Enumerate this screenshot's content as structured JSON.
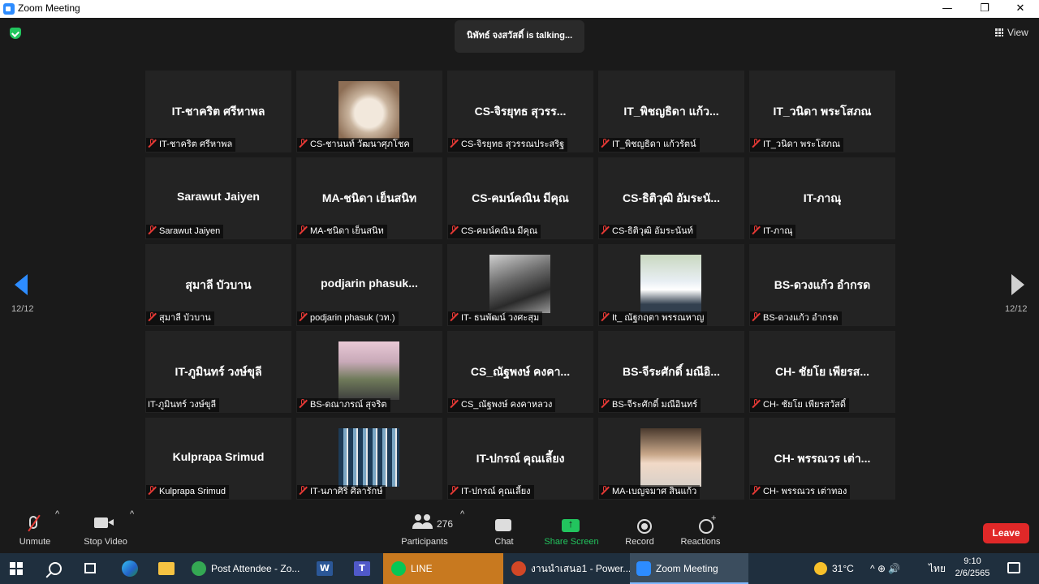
{
  "window": {
    "title": "Zoom Meeting",
    "minimize": "—",
    "restore": "❐",
    "close": "✕"
  },
  "meeting": {
    "talking_indicator": "นิพัทธ์ จงสวัสดิ์ is talking...",
    "view_label": "View",
    "page_left": "12/12",
    "page_right": "12/12"
  },
  "tiles": [
    {
      "display": "IT-ชาคริต ศรีหาพล",
      "label": "IT-ชาคริต ศรีหาพล",
      "photo": "",
      "muted": true
    },
    {
      "display": "",
      "label": "CS-ชานนท์ วัฒนาศุภโชค",
      "photo": "ph-cat",
      "muted": true
    },
    {
      "display": "CS-จิรยุทธ สุวรร...",
      "label": "CS-จิรยุทธ สุวรรณประสริฐ",
      "photo": "",
      "muted": true
    },
    {
      "display": "IT_พิชญธิดา แก้ว...",
      "label": "IT_พิชญธิดา แก้วรัตน์",
      "photo": "",
      "muted": true
    },
    {
      "display": "IT_วนิดา พระโสภณ",
      "label": "IT_วนิดา พระโสภณ",
      "photo": "",
      "muted": true
    },
    {
      "display": "Sarawut Jaiyen",
      "label": "Sarawut Jaiyen",
      "photo": "",
      "muted": true
    },
    {
      "display": "MA-ชนิดา เย็นสนิท",
      "label": "MA-ชนิดา เย็นสนิท",
      "photo": "",
      "muted": true
    },
    {
      "display": "CS-คมน์คณิน มีคุณ",
      "label": "CS-คมน์คณิน มีคุณ",
      "photo": "",
      "muted": true
    },
    {
      "display": "CS-ธิติวุฒิ อัมระนั...",
      "label": "CS-ธิติวุฒิ อัมระนันท์",
      "photo": "",
      "muted": true
    },
    {
      "display": "IT-ภาณุ",
      "label": "IT-ภาณุ",
      "photo": "",
      "muted": true
    },
    {
      "display": "สุมาลี บัวบาน",
      "label": "สุมาลี บัวบาน",
      "photo": "",
      "muted": true
    },
    {
      "display": "podjarin  phasuk...",
      "label": "podjarin phasuk (วท.)",
      "photo": "",
      "muted": true
    },
    {
      "display": "",
      "label": "IT- ธนพัฒน์ วงศะสุม",
      "photo": "ph-guitar",
      "muted": true
    },
    {
      "display": "",
      "label": "It_ ณัฐกฤตา พรรณหาญ",
      "photo": "ph-uniform",
      "muted": true
    },
    {
      "display": "BS-ดวงแก้ว อำกรด",
      "label": "BS-ดวงแก้ว อำกรด",
      "photo": "",
      "muted": true
    },
    {
      "display": "IT-ภูมินทร์ วงษ์ขุลี",
      "label": "IT-ภูมินทร์ วงษ์ขุลี",
      "photo": "",
      "muted": false
    },
    {
      "display": "",
      "label": "BS-ดณาภรณ์ สุจริต",
      "photo": "ph-tree",
      "muted": true
    },
    {
      "display": "CS_ณัฐพงษ์ คงคา...",
      "label": "CS_ณัฐพงษ์ คงคาหลวง",
      "photo": "",
      "muted": true
    },
    {
      "display": "BS-จีระศักดิ์ มณีอิ...",
      "label": "BS-จีระศักดิ์ มณีอินทร์",
      "photo": "",
      "muted": true
    },
    {
      "display": "CH- ชัยโย เพียรส...",
      "label": "CH- ชัยโย เพียรสวัสดิ์",
      "photo": "",
      "muted": true
    },
    {
      "display": "Kulprapa Srimud",
      "label": "Kulprapa Srimud",
      "photo": "",
      "muted": true
    },
    {
      "display": "",
      "label": "IT-นภาศิริ ศิลารักษ์",
      "photo": "ph-shelf",
      "muted": true
    },
    {
      "display": "IT-ปกรณ์ คุณเลี้ยง",
      "label": "IT-ปกรณ์ คุณเลี้ยง",
      "photo": "",
      "muted": true
    },
    {
      "display": "",
      "label": "MA-เบญจมาศ สินแก้ว",
      "photo": "ph-girl",
      "muted": true
    },
    {
      "display": "CH- พรรณวร เต่า...",
      "label": "CH- พรรณวร เต่าทอง",
      "photo": "",
      "muted": true
    }
  ],
  "toolbar": {
    "unmute": "Unmute",
    "stop_video": "Stop Video",
    "participants": "Participants",
    "participants_count": "276",
    "chat": "Chat",
    "share_screen": "Share Screen",
    "record": "Record",
    "reactions": "Reactions",
    "leave": "Leave",
    "caret": "^"
  },
  "taskbar": {
    "apps": [
      {
        "label": "Post Attendee - Zo...",
        "color": "#34a853"
      },
      {
        "label": "LINE",
        "color": "#06c755"
      },
      {
        "label": "งานนำเสนอ1 - Power...",
        "color": "#d24726"
      },
      {
        "label": "Zoom Meeting",
        "color": "#2d8cff"
      }
    ],
    "word_letter": "W",
    "teams_letter": "T",
    "temperature": "31°C",
    "tray_icons": "^  ⊕  🔊",
    "language": "ไทย",
    "time": "9:10",
    "date": "2/6/2565"
  },
  "colors": {
    "accent": "#2d8cff",
    "share_green": "#22c55e",
    "leave_red": "#e02828",
    "muted_red": "#e53935"
  }
}
